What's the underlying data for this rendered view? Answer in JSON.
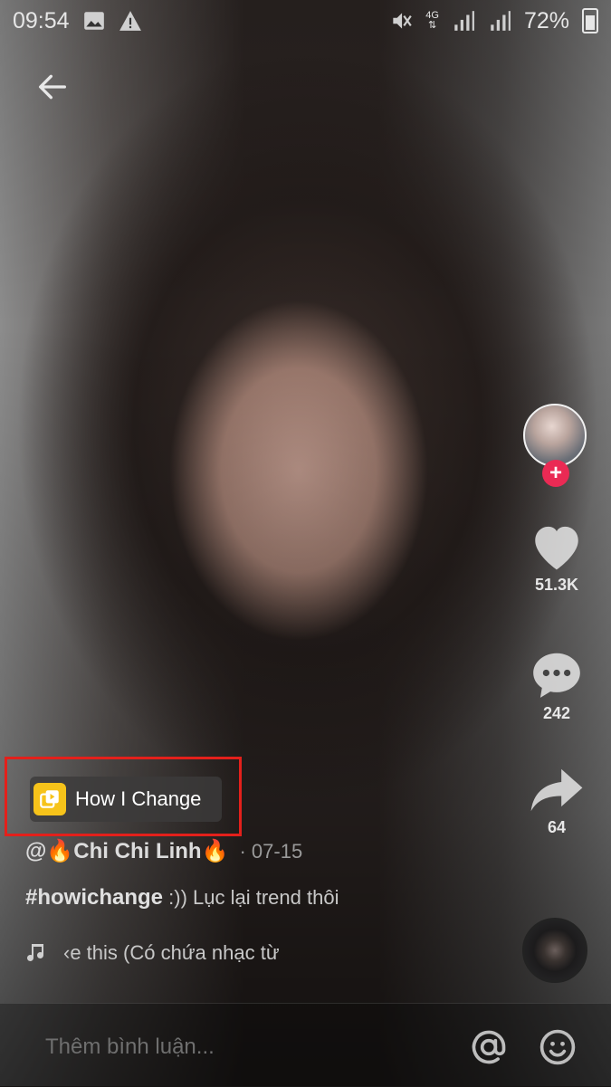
{
  "status_bar": {
    "time": "09:54",
    "network": "4G",
    "battery": "72%"
  },
  "effect": {
    "label": "How I Change"
  },
  "video": {
    "author": "@🔥Chi Chi Linh🔥",
    "date": "· 07-15",
    "hashtag": "#howichange",
    "caption_rest": " :)) Lục lại trend thôi",
    "music": "‹e this (Có chứa nhạc từ"
  },
  "actions": {
    "likes": "51.3K",
    "comments": "242",
    "shares": "64"
  },
  "comment_bar": {
    "placeholder": "Thêm bình luận..."
  }
}
